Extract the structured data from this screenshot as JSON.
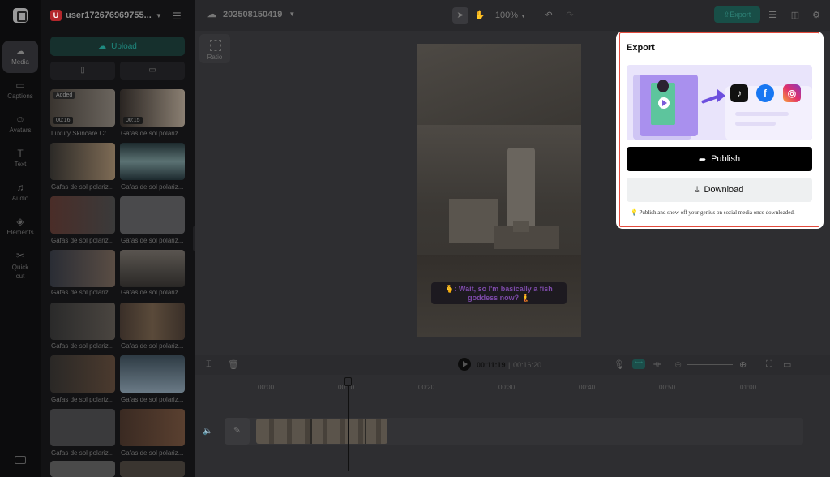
{
  "sidebar": {
    "items": [
      {
        "label": "Media",
        "icon": "media-icon"
      },
      {
        "label": "Captions",
        "icon": "captions-icon"
      },
      {
        "label": "Avatars",
        "icon": "avatars-icon"
      },
      {
        "label": "Text",
        "icon": "text-icon"
      },
      {
        "label": "Audio",
        "icon": "audio-icon"
      },
      {
        "label": "Elements",
        "icon": "elements-icon"
      },
      {
        "label": "Quick cut",
        "icon": "quick-cut-icon"
      }
    ]
  },
  "panel": {
    "workspace_initial": "U",
    "workspace_name": "user172676969755...",
    "upload_label": "Upload",
    "media": [
      {
        "caption": "Luxury Skincare Cr...",
        "badge": "Added",
        "duration": "00:16"
      },
      {
        "caption": "Gafas de sol polariz...",
        "badge": "",
        "duration": "00:15"
      },
      {
        "caption": "Gafas de sol polariz..."
      },
      {
        "caption": "Gafas de sol polariz..."
      },
      {
        "caption": "Gafas de sol polariz..."
      },
      {
        "caption": "Gafas de sol polariz..."
      },
      {
        "caption": "Gafas de sol polariz..."
      },
      {
        "caption": "Gafas de sol polariz..."
      },
      {
        "caption": "Gafas de sol polariz..."
      },
      {
        "caption": "Gafas de sol polariz..."
      },
      {
        "caption": "Gafas de sol polariz..."
      },
      {
        "caption": "Gafas de sol polariz..."
      },
      {
        "caption": "Gafas de sol polariz..."
      },
      {
        "caption": "Gafas de sol polariz..."
      }
    ]
  },
  "topbar": {
    "project_name": "202508150419",
    "zoom": "100%",
    "export_label": "Export"
  },
  "ratio_label": "Ratio",
  "canvas": {
    "subtitle": "🫰: Wait, so I'm basically a fish goddess now? 🧜"
  },
  "timeline": {
    "current_time": "00:11:19",
    "total_time": "00:16:20",
    "ticks": [
      "00:00",
      "00:10",
      "00:20",
      "00:30",
      "00:40",
      "00:50",
      "01:00"
    ]
  },
  "export_popup": {
    "title": "Export",
    "publish_label": "Publish",
    "download_label": "Download",
    "note": "💡 Publish and show off your genius on social media once downloaded.",
    "social_icons": [
      "tiktok-icon",
      "facebook-icon",
      "instagram-icon"
    ]
  },
  "colors": {
    "accent": "#1f8a80",
    "highlight_frame": "#e24b3d",
    "publish_bg": "#000000",
    "subtitle_text": "#7d4aa9"
  }
}
